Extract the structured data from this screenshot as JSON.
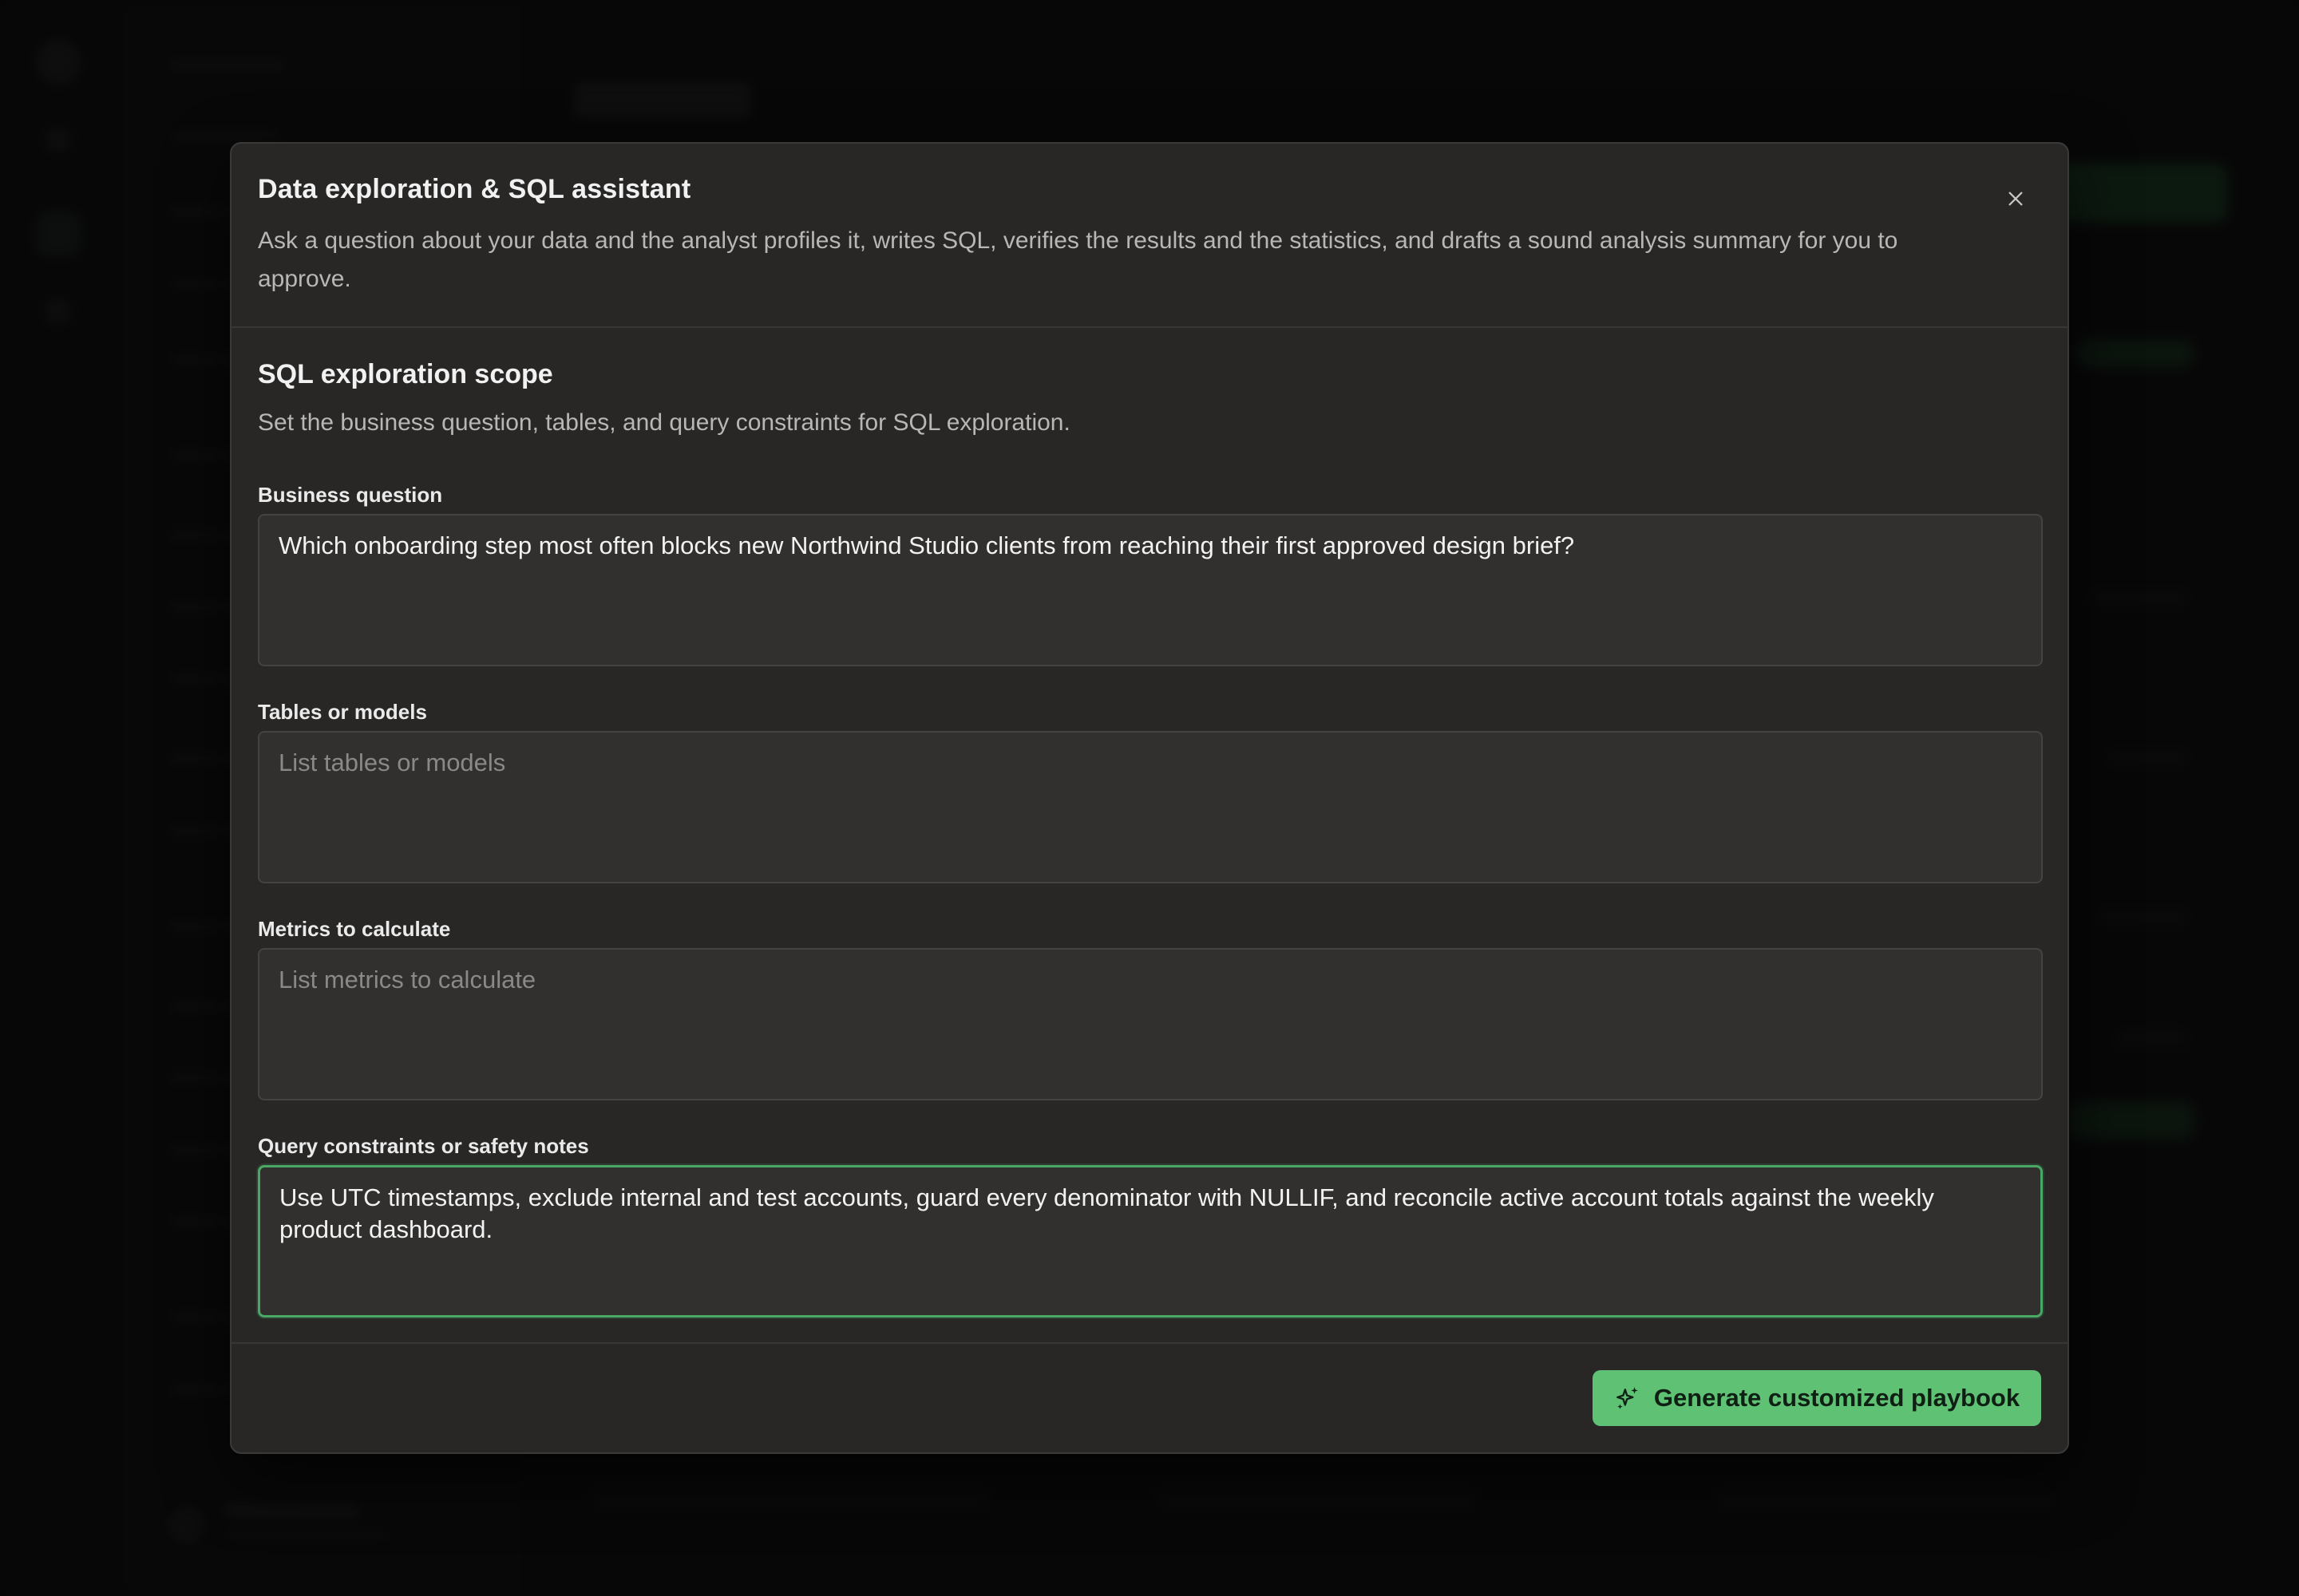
{
  "modal": {
    "title": "Data exploration & SQL assistant",
    "description": "Ask a question about your data and the analyst profiles it, writes SQL, verifies the results and the statistics, and drafts a sound analysis summary for you to approve.",
    "close_icon": "close-icon"
  },
  "section": {
    "title": "SQL exploration scope",
    "description": "Set the business question, tables, and query constraints for SQL exploration."
  },
  "fields": {
    "business_question": {
      "label": "Business question",
      "value": "Which onboarding step most often blocks new Northwind Studio clients from reaching their first approved design brief?",
      "placeholder": ""
    },
    "tables": {
      "label": "Tables or models",
      "value": "",
      "placeholder": "List tables or models"
    },
    "metrics": {
      "label": "Metrics to calculate",
      "value": "",
      "placeholder": "List metrics to calculate"
    },
    "constraints": {
      "label": "Query constraints or safety notes",
      "value": "Use UTC timestamps, exclude internal and test accounts, guard every denominator with NULLIF, and reconcile active account totals against the weekly product dashboard.",
      "placeholder": ""
    }
  },
  "footer": {
    "generate_label": "Generate customized playbook",
    "generate_icon": "sparkle-icon"
  },
  "colors": {
    "accent": "#5ec174",
    "focus_border": "#4aa865",
    "modal_bg": "#282726",
    "field_bg": "#31302f"
  }
}
